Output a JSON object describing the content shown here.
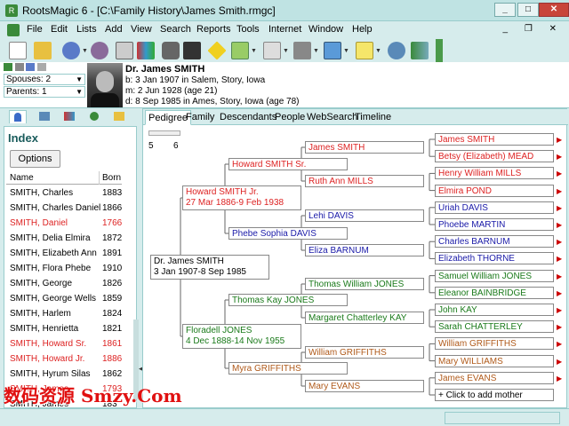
{
  "window": {
    "title": "RootsMagic 6 - [C:\\Family History\\James Smith.rmgc]",
    "min": "_",
    "max": "□",
    "close": "✕"
  },
  "menu": [
    "File",
    "Edit",
    "Lists",
    "Add",
    "View",
    "Search",
    "Reports",
    "Tools",
    "Internet",
    "Window",
    "Help"
  ],
  "mdi_controls": "_ ❐ ✕",
  "header": {
    "spouses": "Spouses: 2",
    "parents": "Parents: 1",
    "name": "Dr. James SMITH",
    "birth": "b: 3 Jan 1907 in Salem, Story, Iowa",
    "marriage": "m: 2 Jun 1928 (age 21)",
    "death": "d: 8 Sep 1985 in Ames, Story, Iowa (age 78)"
  },
  "index": {
    "title": "Index",
    "options_label": "Options",
    "col_name": "Name",
    "col_born": "Born",
    "rows": [
      {
        "name": "SMITH, Charles",
        "born": "1883",
        "red": false
      },
      {
        "name": "SMITH, Charles Daniel",
        "born": "1866",
        "red": false
      },
      {
        "name": "SMITH, Daniel",
        "born": "1766",
        "red": true
      },
      {
        "name": "SMITH, Delia Elmira",
        "born": "1872",
        "red": false
      },
      {
        "name": "SMITH, Elizabeth Ann",
        "born": "1891",
        "red": false
      },
      {
        "name": "SMITH, Flora Phebe",
        "born": "1910",
        "red": false
      },
      {
        "name": "SMITH, George",
        "born": "1826",
        "red": false
      },
      {
        "name": "SMITH, George Wells",
        "born": "1859",
        "red": false
      },
      {
        "name": "SMITH, Harlem",
        "born": "1824",
        "red": false
      },
      {
        "name": "SMITH, Henrietta",
        "born": "1821",
        "red": false
      },
      {
        "name": "SMITH, Howard Sr.",
        "born": "1861",
        "red": true
      },
      {
        "name": "SMITH, Howard Jr.",
        "born": "1886",
        "red": true
      },
      {
        "name": "SMITH, Hyrum Silas",
        "born": "1862",
        "red": false
      },
      {
        "name": "SMITH, James",
        "born": "1793",
        "red": true
      },
      {
        "name": "SMITH, James",
        "born": "183",
        "red": false
      }
    ]
  },
  "view_tabs": [
    "Pedigree",
    "Family",
    "Descendants",
    "People",
    "WebSearch",
    "Timeline"
  ],
  "generations": {
    "min": "5",
    "max": "6"
  },
  "pedigree": {
    "root": {
      "name": "Dr. James SMITH",
      "dates": "3 Jan 1907-8 Sep 1985"
    },
    "father": {
      "name": "Howard SMITH Jr.",
      "dates": "27 Mar 1886-9 Feb 1938"
    },
    "mother": {
      "name": "Floradell JONES",
      "dates": "4 Dec 1888-14 Nov 1955"
    },
    "gen3": [
      "Howard SMITH Sr.",
      "Phebe Sophia DAVIS",
      "Thomas Kay JONES",
      "Myra GRIFFITHS"
    ],
    "gen4": [
      "James SMITH",
      "Ruth Ann MILLS",
      "Lehi DAVIS",
      "Eliza BARNUM",
      "Thomas William JONES",
      "Margaret Chatterley KAY",
      "William GRIFFITHS",
      "Mary EVANS"
    ],
    "gen5": [
      "James SMITH",
      "Betsy (Elizabeth) MEAD",
      "Henry William MILLS",
      "Elmira POND",
      "Uriah DAVIS",
      "Phoebe MARTIN",
      "Charles BARNUM",
      "Elizabeth THORNE",
      "Samuel William JONES",
      "Eleanor BAINBRIDGE",
      "John KAY",
      "Sarah CHATTERLEY",
      "William GRIFFITHS",
      "Mary WILLIAMS",
      "James EVANS",
      "+ Click to add mother"
    ]
  },
  "watermark": "数码资源 Smzy.Com",
  "colors": {
    "paternal": "#d22",
    "maternal": "#1a7a1a",
    "male_blue": "#1a1aa8",
    "orange": "#b05a1a"
  }
}
